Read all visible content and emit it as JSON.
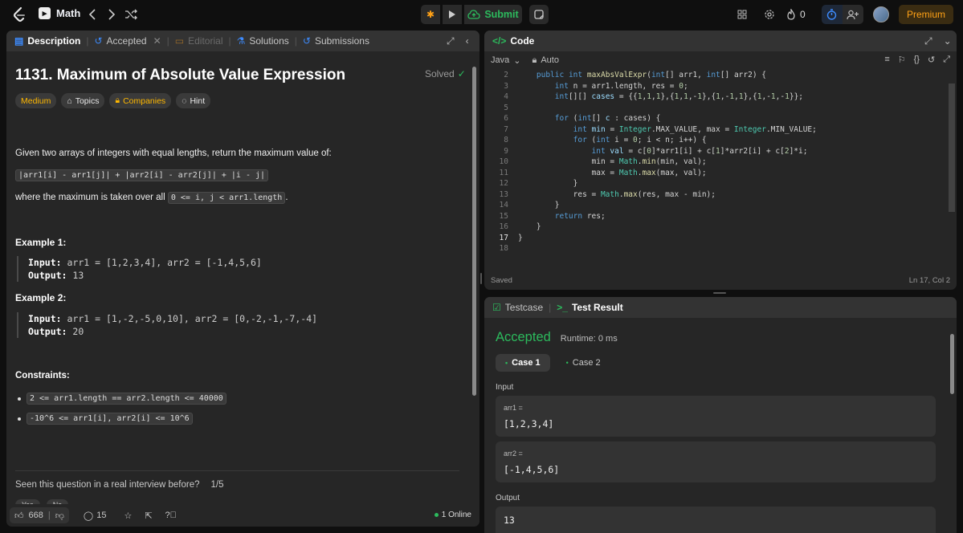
{
  "topbar": {
    "problem_list_label": "Math",
    "submit_label": "Submit",
    "streak_count": "0",
    "premium_label": "Premium"
  },
  "left_panel": {
    "tabs": [
      {
        "label": "Description"
      },
      {
        "label": "Accepted"
      },
      {
        "label": "Editorial"
      },
      {
        "label": "Solutions"
      },
      {
        "label": "Submissions"
      }
    ],
    "title": "1131. Maximum of Absolute Value Expression",
    "solved_label": "Solved",
    "tags": {
      "difficulty": "Medium",
      "topics": "Topics",
      "companies": "Companies",
      "hint": "Hint"
    },
    "intro": "Given two arrays of integers with equal lengths, return the maximum value of:",
    "expression": "|arr1[i] - arr1[j]| + |arr2[i] - arr2[j]| + |i - j|",
    "where_prefix": "where the maximum is taken over all",
    "where_code": "0 <= i, j < arr1.length",
    "where_suffix": ".",
    "example1": {
      "heading": "Example 1:",
      "input_label": "Input:",
      "input": "arr1 = [1,2,3,4], arr2 = [-1,4,5,6]",
      "output_label": "Output:",
      "output": "13"
    },
    "example2": {
      "heading": "Example 2:",
      "input_label": "Input:",
      "input": "arr1 = [1,-2,-5,0,10], arr2 = [0,-2,-1,-7,-4]",
      "output_label": "Output:",
      "output": "20"
    },
    "constraints_heading": "Constraints:",
    "constraints": [
      "2 <= arr1.length == arr2.length <= 40000",
      "-10^6 <= arr1[i], arr2[i] <= 10^6"
    ],
    "interview_question": "Seen this question in a real interview before?",
    "interview_page": "1/5",
    "yes_label": "Yes",
    "no_label": "No",
    "likes": "668",
    "comments": "15",
    "online": "1 Online"
  },
  "code_panel": {
    "title": "Code",
    "language": "Java",
    "mode": "Auto",
    "saved": "Saved",
    "cursor": "Ln 17, Col 2",
    "line_numbers": [
      "2",
      "3",
      "4",
      "5",
      "6",
      "7",
      "8",
      "9",
      "10",
      "11",
      "12",
      "13",
      "14",
      "15",
      "16",
      "17",
      "18"
    ],
    "current_line": "17"
  },
  "result_panel": {
    "tabs": [
      {
        "label": "Testcase"
      },
      {
        "label": "Test Result"
      }
    ],
    "status": "Accepted",
    "runtime": "Runtime: 0 ms",
    "cases": [
      {
        "label": "Case 1"
      },
      {
        "label": "Case 2"
      }
    ],
    "input_label": "Input",
    "inputs": [
      {
        "name": "arr1 =",
        "value": "[1,2,3,4]"
      },
      {
        "name": "arr2 =",
        "value": "[-1,4,5,6]"
      }
    ],
    "output_label": "Output",
    "output_value": "13"
  }
}
